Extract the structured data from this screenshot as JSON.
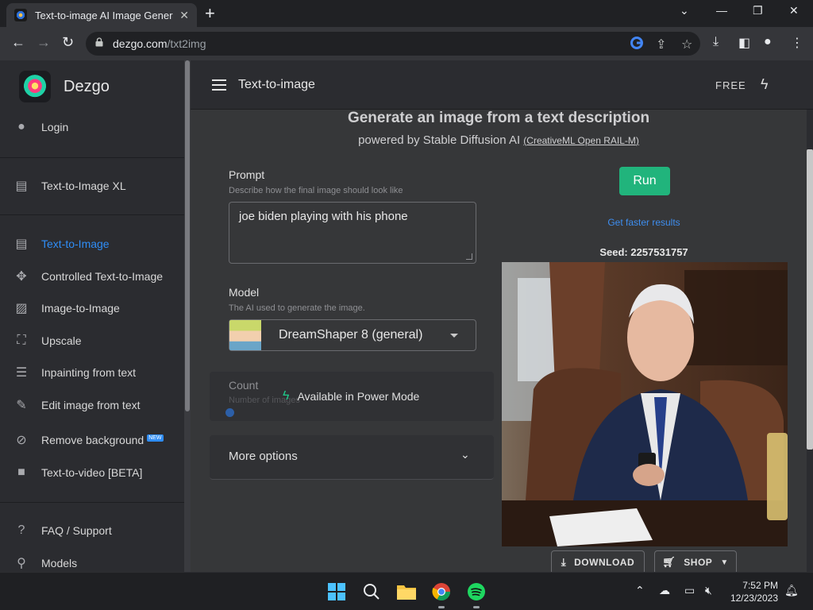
{
  "browser": {
    "tab_title": "Text-to-image AI Image Generator",
    "url_domain": "dezgo.com",
    "url_path": "/txt2img"
  },
  "sidebar": {
    "brand": "Dezgo",
    "login": "Login",
    "items": [
      {
        "label": "Text-to-Image XL",
        "icon": "chat-icon"
      },
      {
        "label": "Text-to-Image",
        "icon": "chat-icon",
        "active": true
      },
      {
        "label": "Controlled Text-to-Image",
        "icon": "move-icon"
      },
      {
        "label": "Image-to-Image",
        "icon": "image-icon"
      },
      {
        "label": "Upscale",
        "icon": "crop-icon"
      },
      {
        "label": "Inpainting from text",
        "icon": "notes-icon"
      },
      {
        "label": "Edit image from text",
        "icon": "edit-icon"
      },
      {
        "label": "Remove background",
        "icon": "hide-image-icon",
        "badge": "NEW"
      },
      {
        "label": "Text-to-video [BETA]",
        "icon": "video-icon"
      },
      {
        "label": "FAQ / Support",
        "icon": "help-icon"
      },
      {
        "label": "Models",
        "icon": "pin-icon"
      }
    ]
  },
  "appbar": {
    "title": "Text-to-image",
    "plan": "FREE"
  },
  "main": {
    "heading": "Generate an image from a text description",
    "subheading": "powered by Stable Diffusion AI",
    "license": "CreativeML Open RAIL-M",
    "prompt_label": "Prompt",
    "prompt_help": "Describe how the final image should look like",
    "prompt_value": "joe biden playing with his phone",
    "model_label": "Model",
    "model_help": "The AI used to generate the image.",
    "model_value": "DreamShaper 8 (general)",
    "count_label": "Count",
    "count_help": "Number of images",
    "power_mode": "Available in Power Mode",
    "more_options": "More options",
    "run": "Run",
    "faster": "Get faster results",
    "seed": "Seed: 2257531757",
    "download": "DOWNLOAD",
    "shop": "SHOP"
  },
  "taskbar": {
    "time": "7:52 PM",
    "date": "12/23/2023"
  },
  "colors": {
    "accent": "#2f8df6",
    "run_green": "#21b47c",
    "background": "#2b2c30"
  }
}
